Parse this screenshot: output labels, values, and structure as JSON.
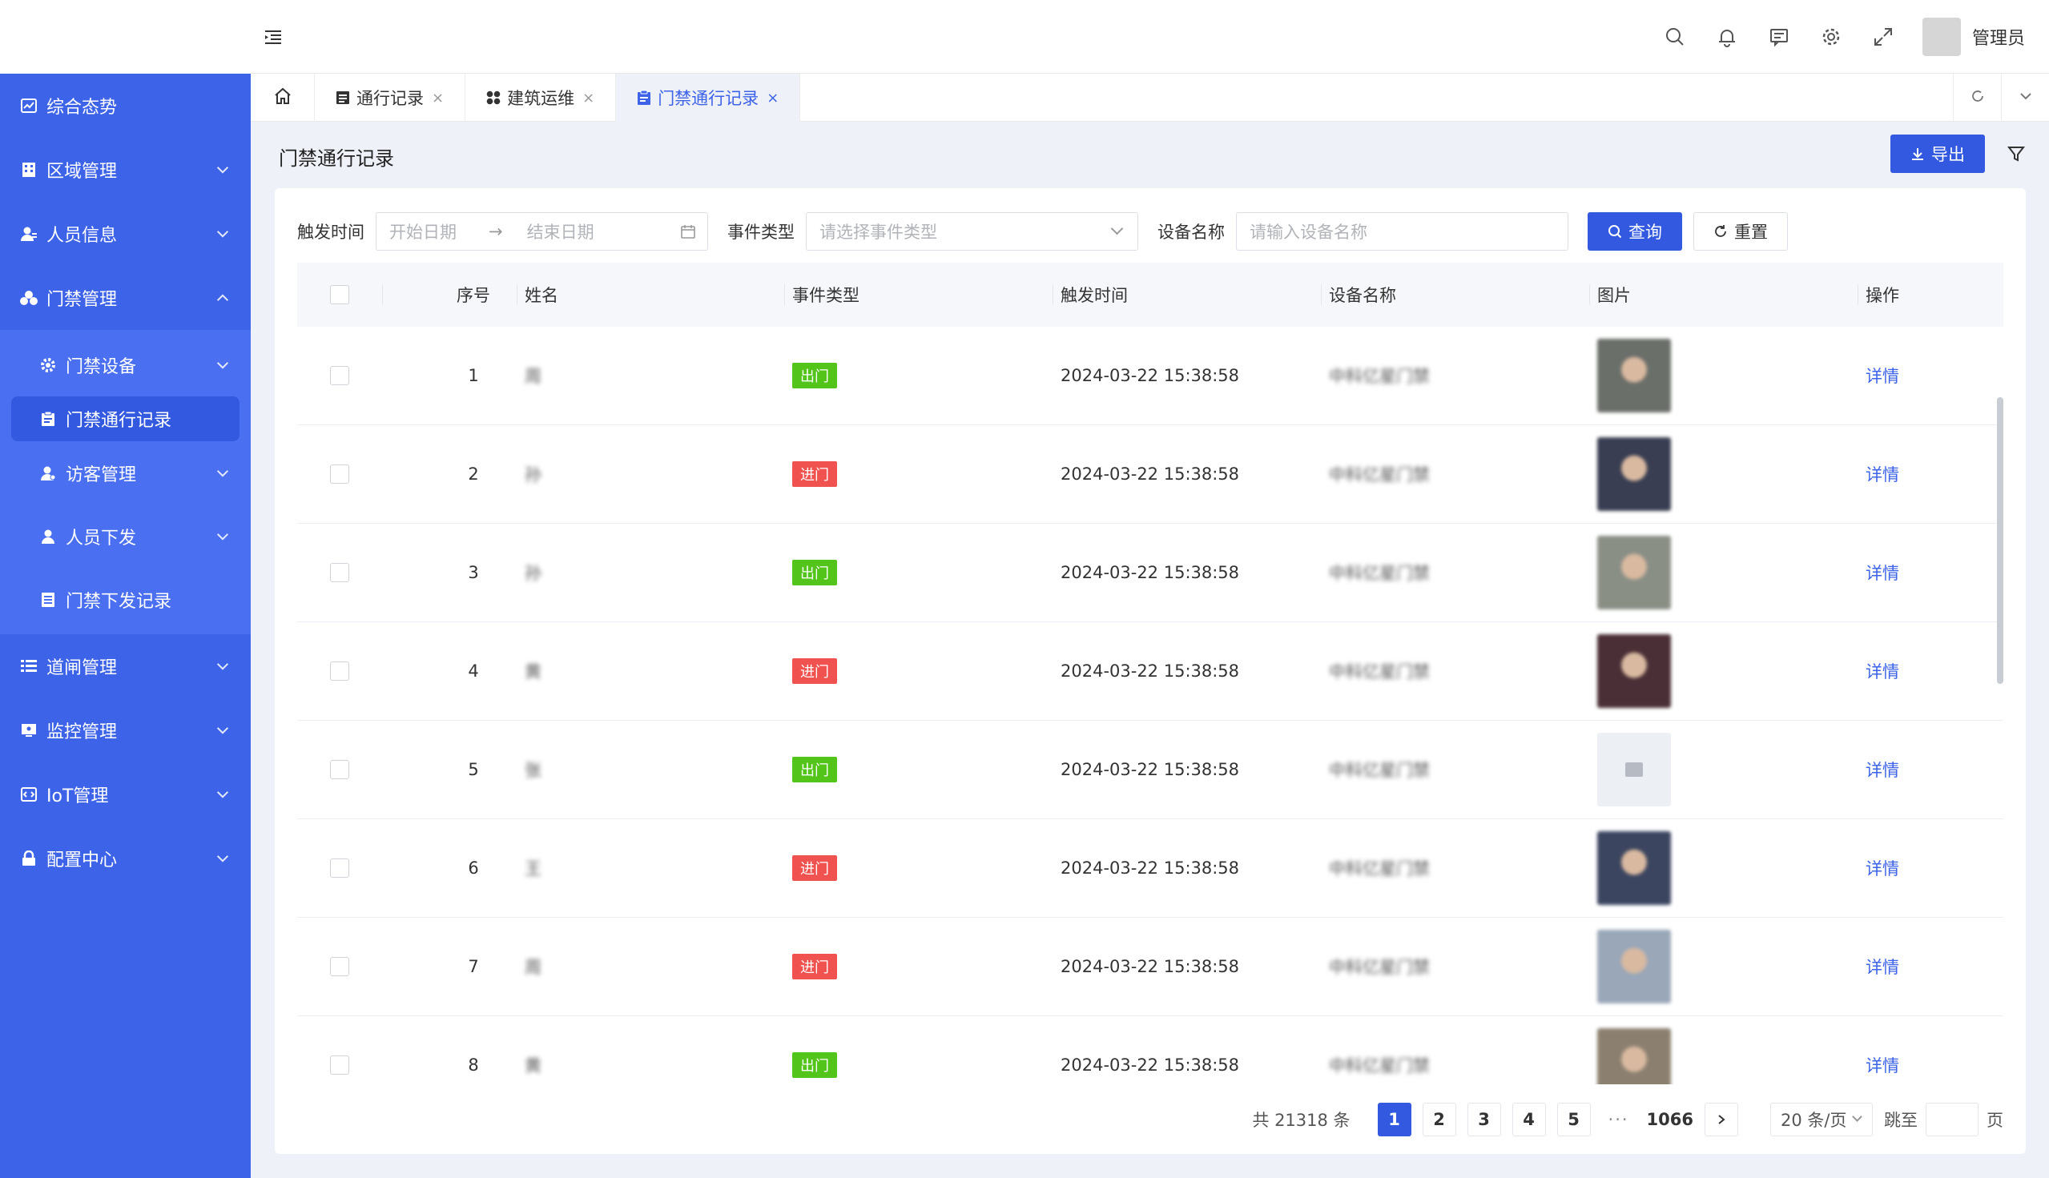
{
  "sidebar": {
    "items": [
      {
        "label": "综合态势",
        "icon": "chart-icon"
      },
      {
        "label": "区域管理",
        "icon": "building-icon"
      },
      {
        "label": "人员信息",
        "icon": "user-icon"
      },
      {
        "label": "门禁管理",
        "icon": "group-icon",
        "expanded": true
      },
      {
        "label": "道闸管理",
        "icon": "list-icon"
      },
      {
        "label": "监控管理",
        "icon": "monitor-icon"
      },
      {
        "label": "IoT管理",
        "icon": "iot-icon"
      },
      {
        "label": "配置中心",
        "icon": "lock-icon"
      }
    ],
    "subitems": [
      {
        "label": "门禁设备",
        "icon": "gear-icon"
      },
      {
        "label": "门禁通行记录",
        "icon": "clipboard-icon",
        "active": true
      },
      {
        "label": "访客管理",
        "icon": "visitor-icon"
      },
      {
        "label": "人员下发",
        "icon": "person-icon"
      },
      {
        "label": "门禁下发记录",
        "icon": "doc-icon"
      }
    ]
  },
  "header": {
    "username": "管理员"
  },
  "tabs": [
    {
      "label": "通行记录",
      "icon": "doc-icon"
    },
    {
      "label": "建筑运维",
      "icon": "grid-icon"
    },
    {
      "label": "门禁通行记录",
      "icon": "clipboard-icon",
      "active": true
    }
  ],
  "page": {
    "title": "门禁通行记录",
    "export_label": "导出"
  },
  "search": {
    "trigger_time_label": "触发时间",
    "start_placeholder": "开始日期",
    "end_placeholder": "结束日期",
    "event_type_label": "事件类型",
    "event_type_placeholder": "请选择事件类型",
    "device_name_label": "设备名称",
    "device_name_placeholder": "请输入设备名称",
    "query_label": "查询",
    "reset_label": "重置"
  },
  "table": {
    "columns": [
      "序号",
      "姓名",
      "事件类型",
      "触发时间",
      "设备名称",
      "图片",
      "操作"
    ],
    "rows": [
      {
        "idx": "1",
        "name": "周",
        "type": "出门",
        "type_kind": "out",
        "time": "2024-03-22 15:38:58",
        "device": "中科亿星门禁",
        "photo": "#6b6f6a",
        "action": "详情"
      },
      {
        "idx": "2",
        "name": "孙",
        "type": "进门",
        "type_kind": "in",
        "time": "2024-03-22 15:38:58",
        "device": "中科亿星门禁",
        "photo": "#3a3e52",
        "action": "详情"
      },
      {
        "idx": "3",
        "name": "孙",
        "type": "出门",
        "type_kind": "out",
        "time": "2024-03-22 15:38:58",
        "device": "中科亿星门禁",
        "photo": "#8a8f86",
        "action": "详情"
      },
      {
        "idx": "4",
        "name": "黄",
        "type": "进门",
        "type_kind": "in",
        "time": "2024-03-22 15:38:58",
        "device": "中科亿星门禁",
        "photo": "#4a3036",
        "action": "详情"
      },
      {
        "idx": "5",
        "name": "张",
        "type": "出门",
        "type_kind": "out",
        "time": "2024-03-22 15:38:58",
        "device": "中科亿星门禁",
        "photo": "",
        "action": "详情"
      },
      {
        "idx": "6",
        "name": "王",
        "type": "进门",
        "type_kind": "in",
        "time": "2024-03-22 15:38:58",
        "device": "中科亿星门禁",
        "photo": "#3c4560",
        "action": "详情"
      },
      {
        "idx": "7",
        "name": "周",
        "type": "进门",
        "type_kind": "in",
        "time": "2024-03-22 15:38:58",
        "device": "中科亿星门禁",
        "photo": "#9aa7b8",
        "action": "详情"
      },
      {
        "idx": "8",
        "name": "黄",
        "type": "出门",
        "type_kind": "out",
        "time": "2024-03-22 15:38:58",
        "device": "中科亿星门禁",
        "photo": "#8b8070",
        "action": "详情"
      }
    ]
  },
  "pagination": {
    "total_text": "共 21318 条",
    "pages": [
      "1",
      "2",
      "3",
      "4",
      "5"
    ],
    "ellipsis": "···",
    "last_page": "1066",
    "page_size": "20 条/页",
    "jump_label": "跳至",
    "page_unit": "页"
  },
  "colors": {
    "sidebar": "#3d63e8",
    "primary": "#3259e0",
    "tag_out": "#52c41a",
    "tag_in": "#f0524f"
  }
}
